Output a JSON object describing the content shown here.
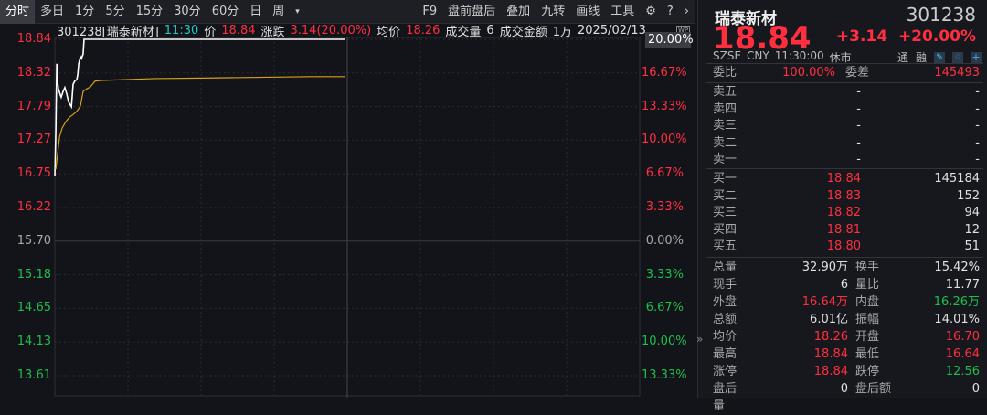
{
  "toolbar": {
    "left": [
      "分时",
      "多日",
      "1分",
      "5分",
      "15分",
      "30分",
      "60分",
      "日",
      "周"
    ],
    "more": "▾",
    "right": [
      "F9",
      "盘前盘后",
      "叠加",
      "九转",
      "画线",
      "工具"
    ]
  },
  "info": {
    "code_name": "301238[瑞泰新材]",
    "time": "11:30",
    "price_label": "价",
    "price": "18.84",
    "change_label": "涨跌",
    "change": "3.14(20.00%)",
    "avg_label": "均价",
    "avg": "18.26",
    "vol_label": "成交量",
    "vol": "6",
    "amt_label": "成交金额",
    "amt": "1万",
    "date": "2025/02/13"
  },
  "left_axis": [
    "18.84",
    "18.32",
    "17.79",
    "17.27",
    "16.75",
    "16.22",
    "15.70",
    "15.18",
    "14.65",
    "14.13",
    "13.61"
  ],
  "right_axis": [
    "20.00%",
    "16.67%",
    "13.33%",
    "10.00%",
    "6.67%",
    "3.33%",
    "0.00%",
    "3.33%",
    "6.67%",
    "10.00%",
    "13.33%"
  ],
  "wp_badge": "WP",
  "chart_data": {
    "type": "line",
    "x_unit": "minutes since 09:30",
    "ylim": [
      13.61,
      18.84
    ],
    "prev_close": 15.7,
    "series": [
      {
        "name": "价格",
        "color": "#ffffff",
        "x": [
          0,
          0.4,
          0.8,
          1.1,
          1.5,
          2.3,
          2.6,
          3.4,
          4.1,
          4.9,
          5.6,
          6.8,
          7.5,
          8.3,
          9,
          9.4,
          9.8,
          10.5,
          10.9,
          11.6,
          12,
          119
        ],
        "y": [
          16.71,
          17.39,
          18.46,
          18.17,
          18.07,
          17.97,
          17.94,
          18.03,
          18.09,
          17.99,
          17.87,
          17.79,
          18.14,
          18.2,
          18.21,
          18.29,
          18.46,
          18.57,
          18.54,
          18.61,
          18.84,
          18.84
        ]
      },
      {
        "name": "均价",
        "color": "#d4a017",
        "x": [
          0.4,
          1.1,
          1.9,
          3,
          4.5,
          6,
          7.5,
          9,
          10.5,
          11.6,
          13.1,
          14.6,
          16.5,
          18.8,
          26,
          41,
          64,
          105,
          119
        ],
        "y": [
          16.82,
          17.04,
          17.32,
          17.46,
          17.56,
          17.63,
          17.67,
          17.72,
          17.8,
          18.03,
          18.07,
          18.1,
          18.19,
          18.2,
          18.21,
          18.23,
          18.24,
          18.26,
          18.26
        ]
      }
    ]
  },
  "quote": {
    "name": "瑞泰新材",
    "code": "301238",
    "price": "18.84",
    "change": "+3.14",
    "pct": "+20.00%",
    "exchange": "SZSE",
    "currency": "CNY",
    "time": "11:30:00",
    "status": "休市",
    "tag1": "通",
    "tag2": "融"
  },
  "order": {
    "wb_label": "委比",
    "wb": "100.00%",
    "wc_label": "委差",
    "wc": "145493",
    "asks": [
      {
        "l": "卖五",
        "p": "-",
        "v": "-"
      },
      {
        "l": "卖四",
        "p": "-",
        "v": "-"
      },
      {
        "l": "卖三",
        "p": "-",
        "v": "-"
      },
      {
        "l": "卖二",
        "p": "-",
        "v": "-"
      },
      {
        "l": "卖一",
        "p": "-",
        "v": "-"
      }
    ],
    "bids": [
      {
        "l": "买一",
        "p": "18.84",
        "v": "145184"
      },
      {
        "l": "买二",
        "p": "18.83",
        "v": "152"
      },
      {
        "l": "买三",
        "p": "18.82",
        "v": "94"
      },
      {
        "l": "买四",
        "p": "18.81",
        "v": "12"
      },
      {
        "l": "买五",
        "p": "18.80",
        "v": "51"
      }
    ]
  },
  "stats": [
    [
      "总量",
      "32.90万",
      "w",
      "换手",
      "15.42%",
      "w"
    ],
    [
      "现手",
      "6",
      "w",
      "量比",
      "11.77",
      "w"
    ],
    [
      "外盘",
      "16.64万",
      "r",
      "内盘",
      "16.26万",
      "g"
    ],
    [
      "总额",
      "6.01亿",
      "w",
      "振幅",
      "14.01%",
      "w"
    ],
    [
      "均价",
      "18.26",
      "r",
      "开盘",
      "16.70",
      "r"
    ],
    [
      "最高",
      "18.84",
      "r",
      "最低",
      "16.64",
      "r"
    ],
    [
      "涨停",
      "18.84",
      "r",
      "跌停",
      "12.56",
      "g"
    ],
    [
      "盘后量",
      "0",
      "w",
      "盘后额",
      "0",
      "w"
    ]
  ],
  "expand": "»"
}
